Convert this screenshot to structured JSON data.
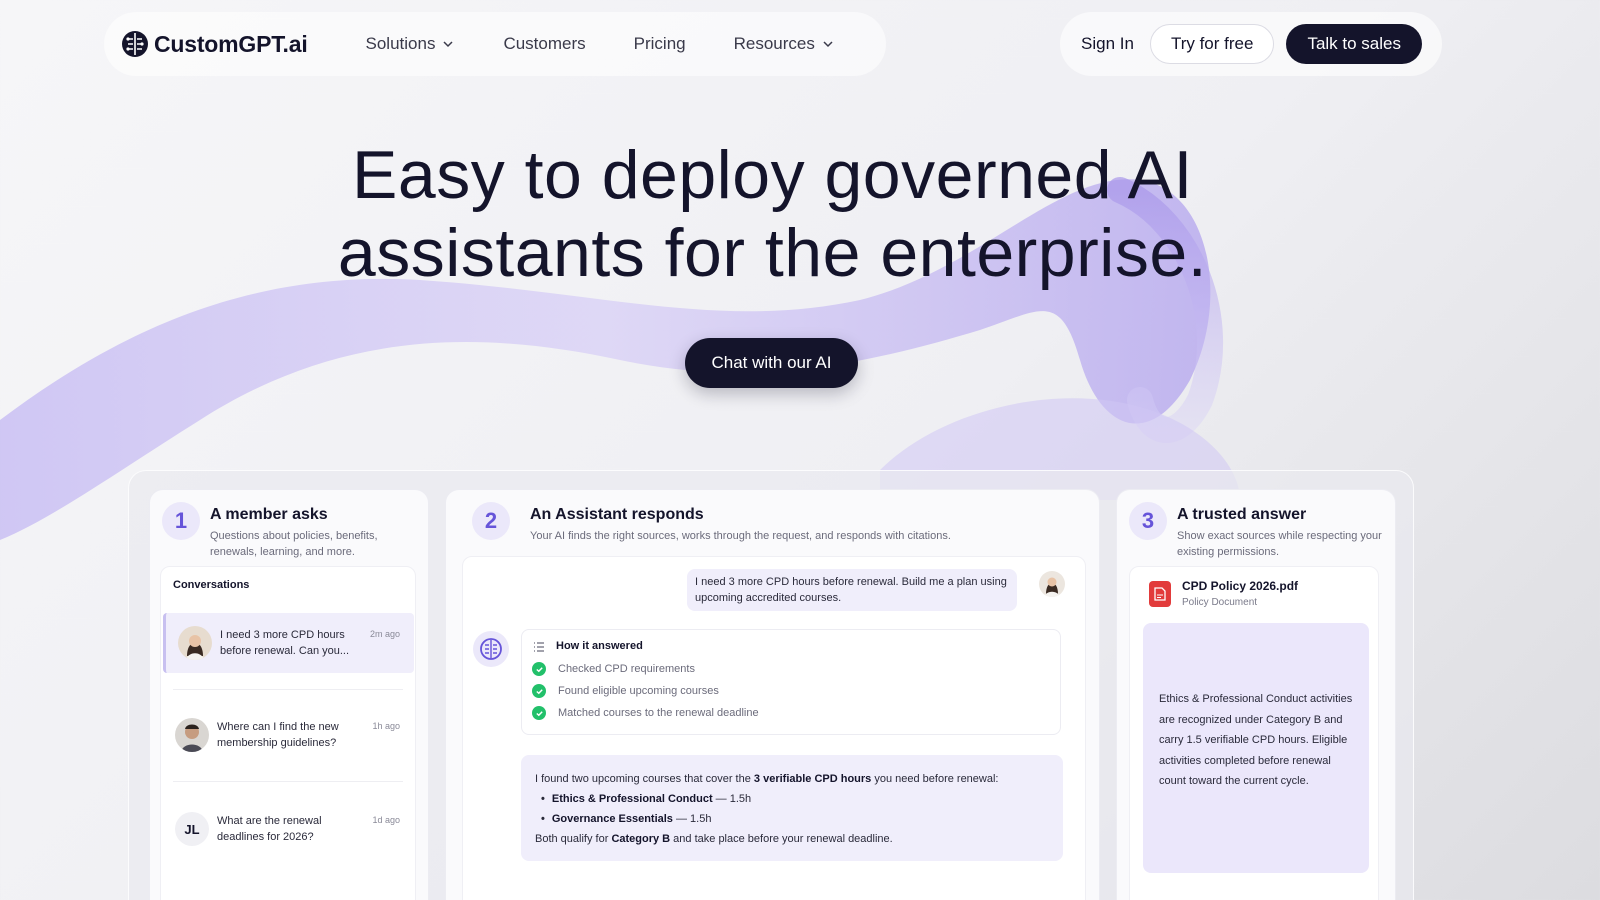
{
  "brand": {
    "name": "CustomGPT.ai",
    "logo_icon": "brain-icon"
  },
  "nav": {
    "links": [
      {
        "label": "Solutions",
        "has_dropdown": true
      },
      {
        "label": "Customers",
        "has_dropdown": false
      },
      {
        "label": "Pricing",
        "has_dropdown": false
      },
      {
        "label": "Resources",
        "has_dropdown": true
      }
    ],
    "sign_in": "Sign In",
    "try_free": "Try for free",
    "talk_sales": "Talk to sales"
  },
  "hero": {
    "title_line1": "Easy to deploy governed AI",
    "title_line2": "assistants for the enterprise.",
    "cta": "Chat with our AI"
  },
  "steps": [
    {
      "num": "1",
      "title": "A member asks",
      "desc": "Questions about policies, benefits, renewals, learning, and more."
    },
    {
      "num": "2",
      "title": "An Assistant responds",
      "desc": "Your AI finds the right sources, works through the request, and responds with citations."
    },
    {
      "num": "3",
      "title": "A trusted answer",
      "desc": "Show exact sources while respecting your existing permissions."
    }
  ],
  "conversations": {
    "heading": "Conversations",
    "items": [
      {
        "text": "I need 3 more CPD hours before renewal. Can you...",
        "time": "2m ago",
        "active": true
      },
      {
        "text": "Where can I find the new membership guidelines?",
        "time": "1h ago",
        "active": false
      },
      {
        "text": "What are the renewal deadlines for 2026?",
        "time": "1d ago",
        "active": false,
        "initials": "JL"
      }
    ]
  },
  "assistant": {
    "user_message": "I need 3 more CPD hours before renewal. Build me a plan using upcoming accredited courses.",
    "how_title": "How it answered",
    "checks": [
      "Checked CPD requirements",
      "Found eligible upcoming courses",
      "Matched courses to the renewal deadline"
    ],
    "answer_intro_pre": "I found two upcoming courses that cover the ",
    "answer_intro_bold": "3 verifiable CPD hours",
    "answer_intro_post": " you need before renewal:",
    "courses": [
      {
        "name": "Ethics & Professional Conduct",
        "hours": " — 1.5h"
      },
      {
        "name": "Governance Essentials",
        "hours": " — 1.5h"
      }
    ],
    "answer_outro_pre": "Both qualify for ",
    "answer_outro_bold": "Category B",
    "answer_outro_post": " and take place before your renewal deadline."
  },
  "source": {
    "doc_name": "CPD Policy 2026.pdf",
    "doc_type": "Policy Document",
    "excerpt": "Ethics & Professional Conduct activities are recognized under Category B and carry 1.5 verifiable CPD hours. Eligible activities completed before renewal count toward the current cycle."
  },
  "colors": {
    "dark": "#14142b",
    "accent": "#6654d9",
    "lavender": "#f0eefb",
    "success": "#22c06a"
  }
}
